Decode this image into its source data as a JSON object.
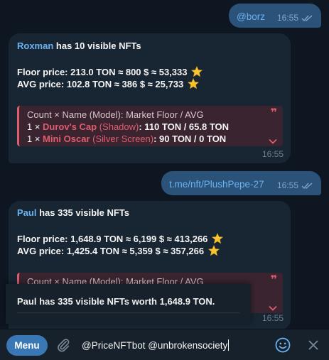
{
  "messages": {
    "out1": {
      "text": "@borz",
      "time": "16:55"
    },
    "in1": {
      "sender": "Roxman",
      "headline_rest": " has 10 visible NFTs",
      "floor_label": "Floor price:",
      "floor_values": " 213.0 TON ≈ 800 $ ≈ 53,333",
      "avg_label": "AVG price:",
      "avg_values": " 102.8 TON ≈ 386 $ ≈ 25,733",
      "quote": {
        "header": "Count × Name (Model): Market Floor / AVG",
        "rows": [
          {
            "count": "1 × ",
            "name": "Durov's Cap",
            "model": " (Shadow)",
            "prices": ": 110 TON / 65.8 TON"
          },
          {
            "count": "1 × ",
            "name": "Mini Oscar",
            "model": " (Silver Screen)",
            "prices": ": 90 TON / 0 TON"
          }
        ]
      },
      "time": "16:55"
    },
    "out2": {
      "text": "t.me/nft/PlushPepe-27",
      "time": "16:55"
    },
    "in2": {
      "sender": "Paul",
      "headline_rest": " has 335 visible NFTs",
      "floor_label": "Floor price:",
      "floor_values": " 1,648.9 TON ≈ 6,199 $ ≈ 413,266",
      "avg_label": "AVG price:",
      "avg_values": " 1,425.4 TON ≈ 5,359 $ ≈ 357,266",
      "quote_header": "Count × Name (Model): Market Floor / AVG",
      "time": "16:55"
    }
  },
  "popup": {
    "text": "Paul has 335 visible NFTs worth 1,648.9 TON."
  },
  "input": {
    "menu_label": "Menu",
    "value": "@PriceNFTbot @unbrokensociety"
  },
  "icons": {
    "star": "star-emoji-icon",
    "read_ticks": "double-check-icon",
    "quote": "quote-mark-icon",
    "expand": "chevron-down-icon",
    "attach": "paperclip-icon",
    "emoji": "smiley-icon",
    "close": "close-icon"
  },
  "colors": {
    "background": "#0e1621",
    "outgoing_bubble": "#2b5278",
    "incoming_bubble": "#182533",
    "accent": "#6ab3f3",
    "quote_accent": "#e05d6f",
    "menu_button": "#3a78b5"
  }
}
